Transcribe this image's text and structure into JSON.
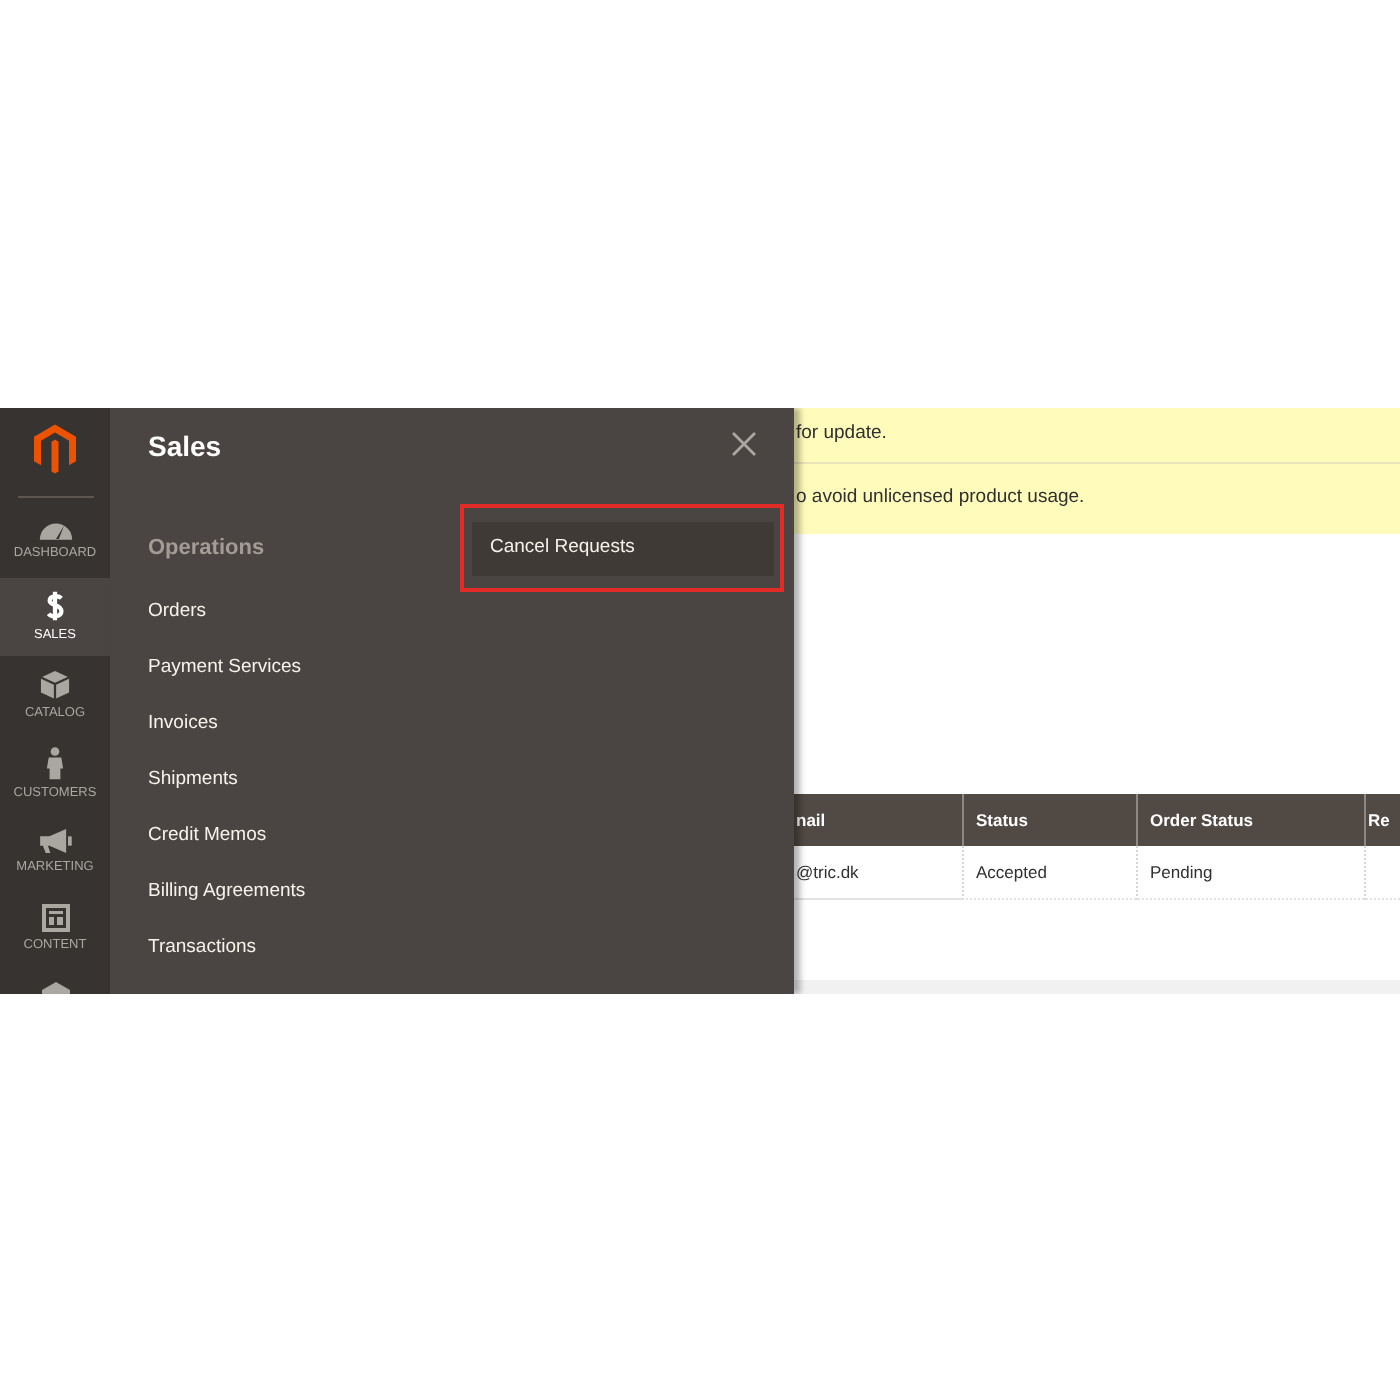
{
  "sidebar": {
    "items": [
      {
        "label": "DASHBOARD",
        "selected": false
      },
      {
        "label": "SALES",
        "selected": true
      },
      {
        "label": "CATALOG",
        "selected": false
      },
      {
        "label": "CUSTOMERS",
        "selected": false
      },
      {
        "label": "MARKETING",
        "selected": false
      },
      {
        "label": "CONTENT",
        "selected": false
      }
    ]
  },
  "menu_panel": {
    "title": "Sales",
    "section": "Operations",
    "items": [
      {
        "label": "Orders",
        "selected": false
      },
      {
        "label": "Payment Services",
        "selected": false
      },
      {
        "label": "Invoices",
        "selected": false
      },
      {
        "label": "Shipments",
        "selected": false
      },
      {
        "label": "Credit Memos",
        "selected": false
      },
      {
        "label": "Billing Agreements",
        "selected": false
      },
      {
        "label": "Transactions",
        "selected": false
      }
    ],
    "column_2": [
      {
        "label": "Cancel Requests",
        "selected": true,
        "highlighted": true
      }
    ]
  },
  "notices": [
    "for update.",
    "o avoid unlicensed product usage."
  ],
  "table": {
    "columns": [
      "nail",
      "Status",
      "Order Status",
      "Re"
    ],
    "rows": [
      {
        "cells": [
          "@tric.dk",
          "Accepted",
          "Pending"
        ]
      }
    ]
  }
}
